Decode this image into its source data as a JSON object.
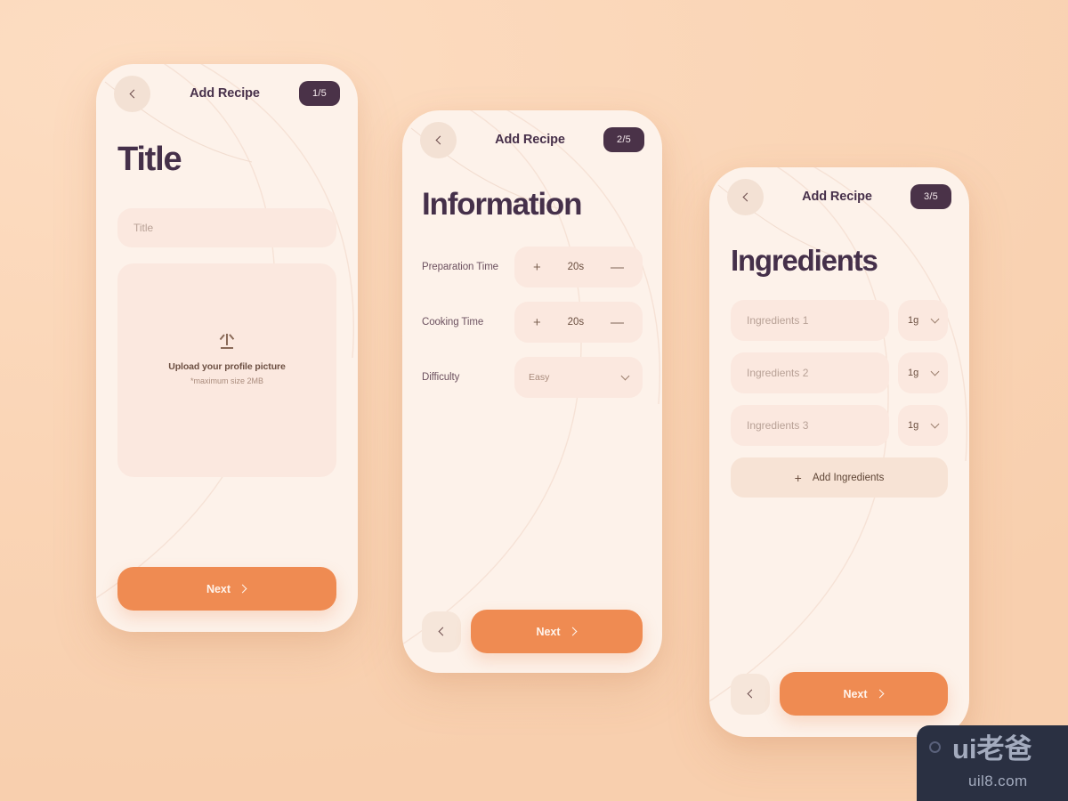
{
  "background": {
    "color": "#fbd8bb"
  },
  "theme": {
    "card_bg": "#fdf2ea",
    "field_bg": "#fbe8df",
    "accent_orange": "#ef8b52",
    "badge_plum": "#4a3248",
    "title_color": "#45304a"
  },
  "screens": [
    {
      "header": {
        "title": "Add Recipe",
        "back_icon": "chevron-left-icon",
        "step": "1/5"
      },
      "page_title": "Title",
      "title_input": {
        "placeholder": "Title",
        "value": ""
      },
      "upload": {
        "icon": "upload-arrow-icon",
        "main_text": "Upload your profile picture",
        "sub_text": "*maximum size 2MB"
      },
      "cta": {
        "label": "Next",
        "icon": "chevron-right-icon"
      }
    },
    {
      "header": {
        "title": "Add Recipe",
        "back_icon": "chevron-left-icon",
        "step": "2/5"
      },
      "page_title": "Information",
      "rows": [
        {
          "label": "Preparation Time",
          "type": "stepper",
          "plus": "+",
          "value": "20s",
          "minus": "—"
        },
        {
          "label": "Cooking Time",
          "type": "stepper",
          "plus": "+",
          "value": "20s",
          "minus": "—"
        },
        {
          "label": "Difficulty",
          "type": "select",
          "value": "Easy",
          "caret_icon": "chevron-down-icon"
        }
      ],
      "footer": {
        "back_icon": "chevron-left-icon",
        "cta": {
          "label": "Next",
          "icon": "chevron-right-icon"
        }
      }
    },
    {
      "header": {
        "title": "Add Recipe",
        "back_icon": "chevron-left-icon",
        "step": "3/5"
      },
      "page_title": "Ingredients",
      "ingredients": [
        {
          "placeholder": "Ingredients 1",
          "unit": "1g",
          "caret_icon": "chevron-down-icon"
        },
        {
          "placeholder": "Ingredients 2",
          "unit": "1g",
          "caret_icon": "chevron-down-icon"
        },
        {
          "placeholder": "Ingredients 3",
          "unit": "1g",
          "caret_icon": "chevron-down-icon"
        }
      ],
      "add_button": {
        "icon": "plus-icon",
        "label": "Add Ingredients"
      },
      "footer": {
        "back_icon": "chevron-left-icon",
        "cta": {
          "label": "Next",
          "icon": "chevron-right-icon"
        }
      }
    }
  ],
  "watermark": {
    "main": "ui老爸",
    "sub": "uil8.com",
    "dot_icon": "circle-icon"
  }
}
